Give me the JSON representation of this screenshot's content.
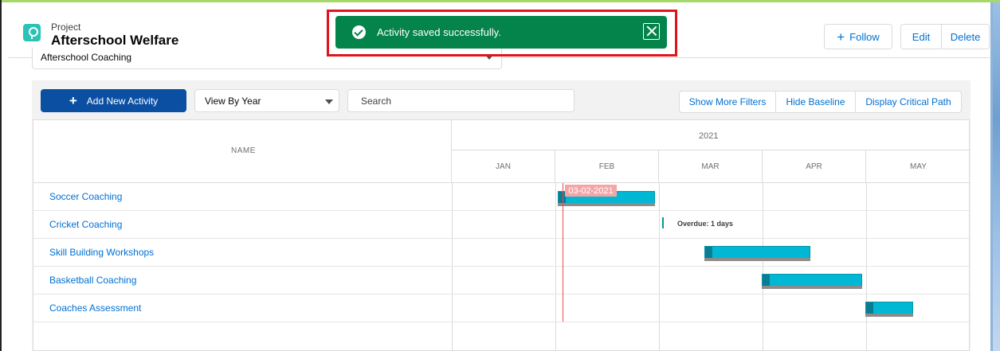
{
  "header": {
    "object_type": "Project",
    "record_title": "Afterschool Welfare",
    "follow_label": "Follow",
    "edit_label": "Edit",
    "delete_label": "Delete"
  },
  "project_select": {
    "value": "Afterschool Coaching"
  },
  "toolbar": {
    "add_label": "Add New Activity",
    "view_value": "View By Year",
    "search_placeholder": "Search",
    "filters_label": "Show More Filters",
    "baseline_label": "Hide Baseline",
    "critical_label": "Display Critical Path"
  },
  "gantt": {
    "name_header": "NAME",
    "year": "2021",
    "months": [
      "JAN",
      "FEB",
      "MAR",
      "APR",
      "MAY"
    ],
    "activities": [
      "Soccer Coaching",
      "Cricket Coaching",
      "Skill Building Workshops",
      "Basketball Coaching",
      "Coaches Assessment"
    ],
    "today_label": "03-02-2021",
    "overdue_label": "Overdue: 1 days",
    "bar_color": "#00b8d4",
    "today_color": "#e35050"
  },
  "toast": {
    "message": "Activity saved successfully.",
    "icon": "check-circle-icon",
    "color": "#04844b"
  },
  "annotation": {
    "color": "#e2141b"
  }
}
